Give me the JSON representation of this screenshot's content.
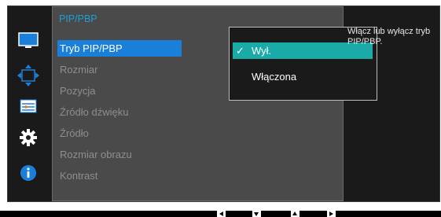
{
  "osd": {
    "icons": [
      {
        "name": "picture-icon",
        "selected": false
      },
      {
        "name": "onscreen-display-icon",
        "selected": true
      },
      {
        "name": "system-icon",
        "selected": false
      },
      {
        "name": "settings-gear-icon",
        "selected": false
      },
      {
        "name": "information-icon",
        "selected": false
      }
    ],
    "menu": {
      "title": "PIP/PBP",
      "items": [
        {
          "label": "Tryb PIP/PBP",
          "active": true
        },
        {
          "label": "Rozmiar",
          "active": false
        },
        {
          "label": "Pozycja",
          "active": false
        },
        {
          "label": "Źródło dźwięku",
          "active": false
        },
        {
          "label": "Źródło",
          "active": false
        },
        {
          "label": "Rozmiar obrazu",
          "active": false
        },
        {
          "label": "Kontrast",
          "active": false
        }
      ]
    },
    "submenu": {
      "options": [
        {
          "label": "Wył.",
          "selected": true
        },
        {
          "label": "Włączona",
          "selected": false
        }
      ]
    },
    "help_text": "Włącz lub wyłącz tryb PIP/PBP."
  },
  "nav": {
    "buttons": [
      "left-arrow-icon",
      "down-arrow-icon",
      "up-arrow-icon",
      "right-arrow-icon"
    ]
  },
  "colors": {
    "accent_blue": "#1a7fd8",
    "accent_teal": "#1aaba8",
    "title_blue": "#1aa0d8",
    "panel_gray": "#4a4a4a",
    "inactive_text": "#8e8e8e"
  }
}
